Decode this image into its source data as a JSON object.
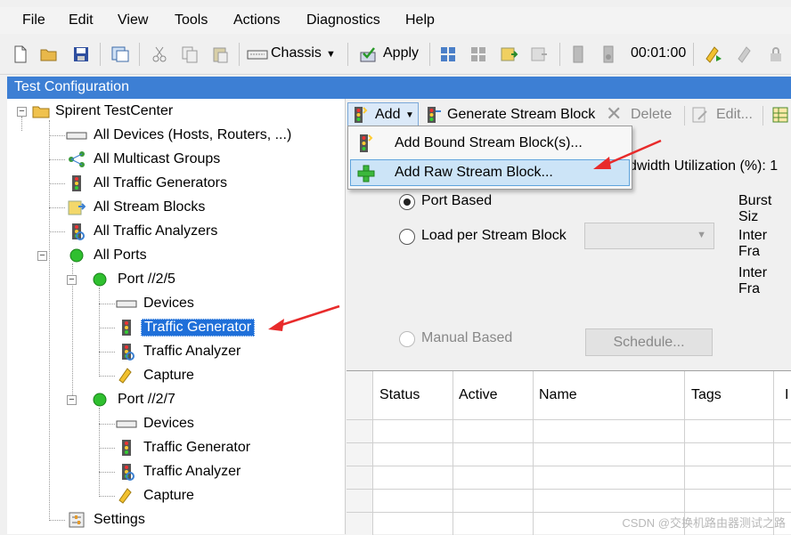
{
  "menu": [
    "File",
    "Edit",
    "View",
    "Tools",
    "Actions",
    "Diagnostics",
    "Help"
  ],
  "toolbar": {
    "chassis": "Chassis",
    "apply": "Apply",
    "timer": "00:01:00"
  },
  "panel_title": "Test Configuration",
  "tree": {
    "root": "Spirent TestCenter",
    "all_devices": "All Devices (Hosts, Routers, ...)",
    "all_multicast": "All Multicast Groups",
    "all_generators": "All Traffic Generators",
    "all_stream_blocks": "All Stream Blocks",
    "all_analyzers": "All Traffic Analyzers",
    "all_ports": "All Ports",
    "port1": "Port //2/5",
    "port1_devices": "Devices",
    "port1_generator": "Traffic Generator",
    "port1_analyzer": "Traffic Analyzer",
    "port1_capture": "Capture",
    "port2": "Port //2/7",
    "port2_devices": "Devices",
    "port2_generator": "Traffic Generator",
    "port2_analyzer": "Traffic Analyzer",
    "port2_capture": "Capture",
    "settings": "Settings"
  },
  "right_toolbar": {
    "add": "Add",
    "generate": "Generate Stream Block",
    "delete": "Delete",
    "edit": "Edit..."
  },
  "dropdown": {
    "bound": "Add Bound Stream Block(s)...",
    "raw": "Add Raw Stream Block..."
  },
  "form": {
    "bandwidth_partial": "dwidth Utilization (%): 1",
    "port_based": "Port Based",
    "load_per_stream": "Load per Stream Block",
    "burst": "Burst Siz",
    "inter_fra1": "Inter Fra",
    "inter_fra2": "Inter Fra",
    "manual_based": "Manual Based",
    "schedule": "Schedule..."
  },
  "grid": {
    "columns": [
      "Status",
      "Active",
      "Name",
      "Tags",
      "I"
    ]
  },
  "watermark": "CSDN @交换机路由器测试之路"
}
